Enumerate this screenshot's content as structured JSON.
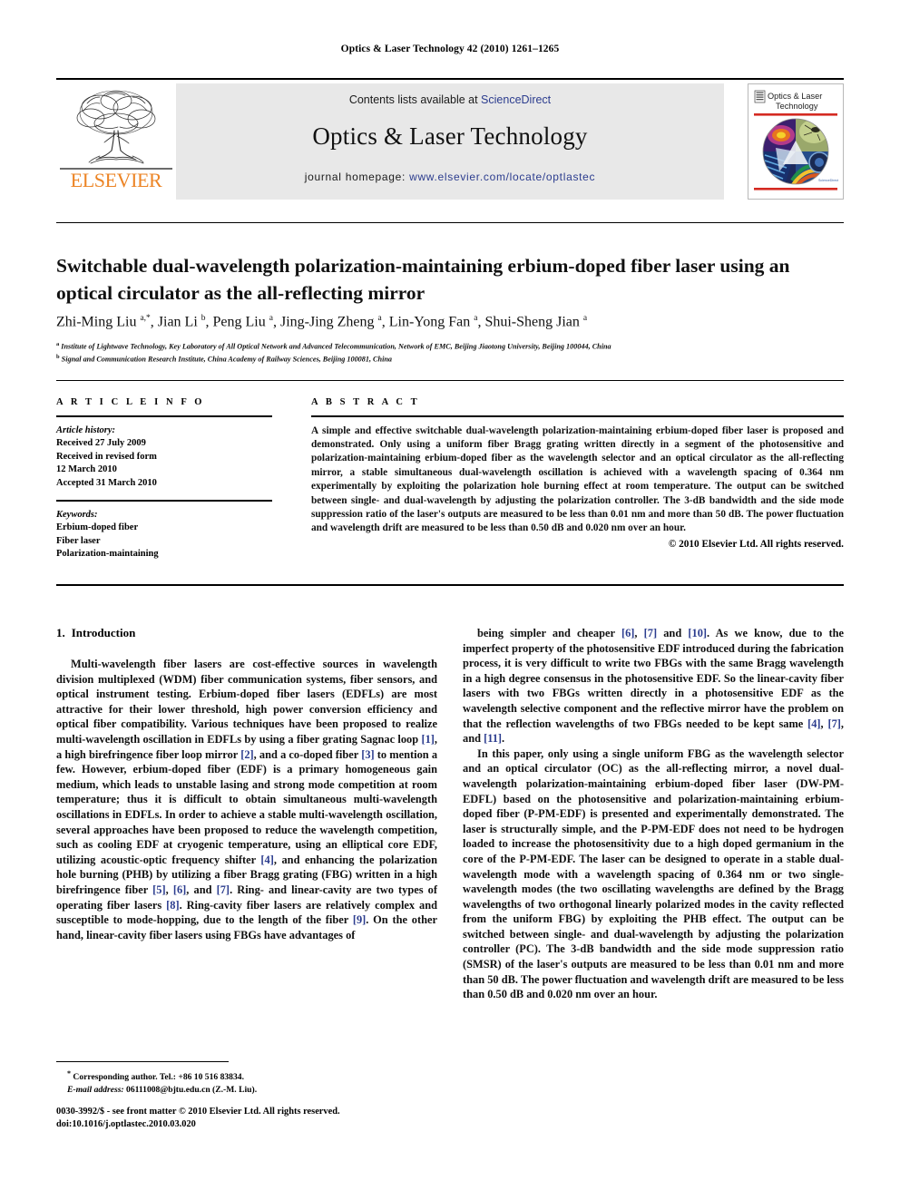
{
  "running_head": "Optics & Laser Technology 42 (2010) 1261–1265",
  "banner": {
    "contents_prefix": "Contents lists available at ",
    "contents_link": "ScienceDirect",
    "journal_title": "Optics & Laser Technology",
    "homepage_prefix": "journal homepage: ",
    "homepage_link": "www.elsevier.com/locate/optlastec",
    "publisher_wordmark": "ELSEVIER",
    "cover_title_line1": "Optics & Laser",
    "cover_title_line2": "Technology",
    "link_color": "#2b3c8e",
    "wordmark_color": "#ec8425"
  },
  "article": {
    "title": "Switchable dual-wavelength polarization-maintaining erbium-doped fiber laser using an optical circulator as the all-reflecting mirror",
    "authors_html": "Zhi-Ming Liu <sup>a,*</sup>, Jian Li <sup>b</sup>, Peng Liu <sup>a</sup>, Jing-Jing Zheng <sup>a</sup>, Lin-Yong Fan <sup>a</sup>, Shui-Sheng Jian <sup>a</sup>",
    "affiliation_a": "Institute of Lightwave Technology, Key Laboratory of All Optical Network and Advanced Telecommunication, Network of EMC, Beijing Jiaotong University, Beijing 100044, China",
    "affiliation_b": "Signal and Communication Research Institute, China Academy of Railway Sciences, Beijing 100081, China"
  },
  "info": {
    "heading": "A R T I C L E  I N F O",
    "history_label": "Article history:",
    "history_lines": [
      "Received 27 July 2009",
      "Received in revised form",
      "12 March 2010",
      "Accepted 31 March 2010"
    ],
    "keywords_label": "Keywords:",
    "keywords": [
      "Erbium-doped fiber",
      "Fiber laser",
      "Polarization-maintaining"
    ]
  },
  "abstract": {
    "heading": "A B S T R A C T",
    "text": "A simple and effective switchable dual-wavelength polarization-maintaining erbium-doped fiber laser is proposed and demonstrated. Only using a uniform fiber Bragg grating written directly in a segment of the photosensitive and polarization-maintaining erbium-doped fiber as the wavelength selector and an optical circulator as the all-reflecting mirror, a stable simultaneous dual-wavelength oscillation is achieved with a wavelength spacing of 0.364 nm experimentally by exploiting the polarization hole burning effect at room temperature. The output can be switched between single- and dual-wavelength by adjusting the polarization controller. The 3-dB bandwidth and the side mode suppression ratio of the laser's outputs are measured to be less than 0.01 nm and more than 50 dB. The power fluctuation and wavelength drift are measured to be less than 0.50 dB and 0.020 nm over an hour.",
    "copyright": "© 2010 Elsevier Ltd. All rights reserved."
  },
  "introduction": {
    "number": "1.",
    "heading": "Introduction",
    "left_paragraph_1_html": "Multi-wavelength fiber lasers are cost-effective sources in wavelength division multiplexed (WDM) fiber communication systems, fiber sensors, and optical instrument testing. Erbium-doped fiber lasers (EDFLs) are most attractive for their lower threshold, high power conversion efficiency and optical fiber compatibility. Various techniques have been proposed to realize multi-wavelength oscillation in EDFLs by using a fiber grating Sagnac loop <span class=\"ref\">[1]</span>, a high birefringence fiber loop mirror <span class=\"ref\">[2]</span>, and a co-doped fiber <span class=\"ref\">[3]</span> to mention a few. However, erbium-doped fiber (EDF) is a primary homogeneous gain medium, which leads to unstable lasing and strong mode competition at room temperature; thus it is difficult to obtain simultaneous multi-wavelength oscillations in EDFLs. In order to achieve a stable multi-wavelength oscillation, several approaches have been proposed to reduce the wavelength competition, such as cooling EDF at cryogenic temperature, using an elliptical core EDF, utilizing acoustic-optic frequency shifter <span class=\"ref\">[4]</span>, and enhancing the polarization hole burning (PHB) by utilizing a fiber Bragg grating (FBG) written in a high birefringence fiber <span class=\"ref\">[5]</span>, <span class=\"ref\">[6]</span>, and <span class=\"ref\">[7]</span>. Ring- and linear-cavity are two types of operating fiber lasers <span class=\"ref\">[8]</span>. Ring-cavity fiber lasers are relatively complex and susceptible to mode-hopping, due to the length of the fiber <span class=\"ref\">[9]</span>. On the other hand, linear-cavity fiber lasers using FBGs have advantages of",
    "right_paragraph_1_html": "being simpler and cheaper <span class=\"ref\">[6]</span>, <span class=\"ref\">[7]</span> and <span class=\"ref\">[10]</span>. As we know, due to the imperfect property of the photosensitive EDF introduced during the fabrication process, it is very difficult to write two FBGs with the same Bragg wavelength in a high degree consensus in the photosensitive EDF. So the linear-cavity fiber lasers with two FBGs written directly in a photosensitive EDF as the wavelength selective component and the reflective mirror have the problem on that the reflection wavelengths of two FBGs needed to be kept same <span class=\"ref\">[4]</span>, <span class=\"ref\">[7]</span>, and <span class=\"ref\">[11]</span>.",
    "right_paragraph_2_html": "In this paper, only using a single uniform FBG as the wavelength selector and an optical circulator (OC) as the all-reflecting mirror, a novel dual-wavelength polarization-maintaining erbium-doped fiber laser (DW-PM-EDFL) based on the photosensitive and polarization-maintaining erbium-doped fiber (P-PM-EDF) is presented and experimentally demonstrated. The laser is structurally simple, and the P-PM-EDF does not need to be hydrogen loaded to increase the photosensitivity due to a high doped germanium in the core of the P-PM-EDF. The laser can be designed to operate in a stable dual-wavelength mode with a wavelength spacing of 0.364 nm or two single-wavelength modes (the two oscillating wavelengths are defined by the Bragg wavelengths of two orthogonal linearly polarized modes in the cavity reflected from the uniform FBG) by exploiting the PHB effect. The output can be switched between single- and dual-wavelength by adjusting the polarization controller (PC). The 3-dB bandwidth and the side mode suppression ratio (SMSR) of the laser's outputs are measured to be less than 0.01 nm and more than 50 dB. The power fluctuation and wavelength drift are measured to be less than 0.50 dB and 0.020 nm over an hour."
  },
  "footnotes": {
    "corresponding_html": "<sup>*</sup> Corresponding author. Tel.: +86 10 516 83834.",
    "email_html": "<em>E-mail address:</em> 06111008@bjtu.edu.cn (Z.-M. Liu).",
    "imprint_line1": "0030-3992/$ - see front matter © 2010 Elsevier Ltd. All rights reserved.",
    "imprint_line2": "doi:10.1016/j.optlastec.2010.03.020"
  }
}
